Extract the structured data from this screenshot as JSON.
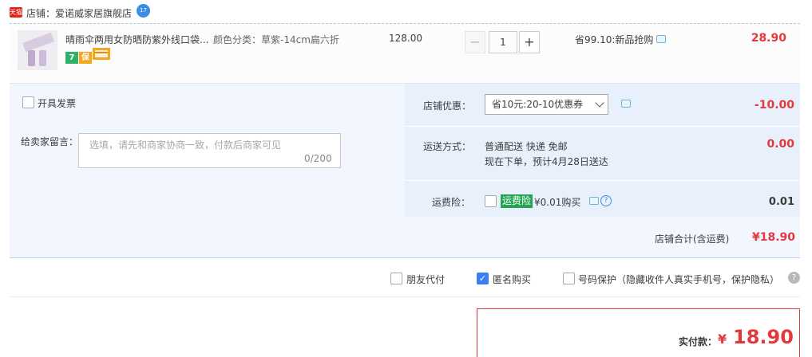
{
  "shop": {
    "badge": "天猫",
    "label": "店铺：爱诺威家居旗舰店",
    "ww_badge": "17"
  },
  "item": {
    "title": "晴雨伞两用女防晒防紫外线口袋...",
    "sku": "颜色分类：草紫-14cm扁六折",
    "price": "128.00",
    "quantity": "1",
    "qty_minus": "−",
    "qty_plus": "+",
    "promo": "省99.10:新品抢购",
    "total": "28.90",
    "service_icons": [
      "7",
      "保",
      "card-icon"
    ]
  },
  "invoice": {
    "label": "开具发票"
  },
  "message": {
    "label": "给卖家留言：",
    "placeholder": "选填，请先和商家协商一致，付款后商家可见",
    "counter": "0/200"
  },
  "coupon": {
    "label": "店铺优惠：",
    "selected": "省10元:20-10优惠券",
    "amount": "-10.00"
  },
  "shipping": {
    "label": "运送方式：",
    "method": "普通配送 快递 免邮",
    "eta": "现在下单，预计4月28日送达",
    "amount": "0.00"
  },
  "insurance": {
    "label": "运费险：",
    "badge": "运费险",
    "text": "¥0.01购买",
    "amount": "0.01"
  },
  "subtotal": {
    "label": "店铺合计(含运费)",
    "amount": "¥18.90"
  },
  "options": {
    "friend_pay": "朋友代付",
    "anonymous": "匿名购买",
    "anonymous_checked": true,
    "phone_protect": "号码保护（隐藏收件人真实手机号，保护隐私）"
  },
  "payment": {
    "label": "实付款：",
    "currency": "¥",
    "amount": "18.90"
  },
  "colors": {
    "accent_red": "#e4393c",
    "tmall_red": "#e2231a",
    "panel_blue": "#f2f7ff",
    "insurance_green": "#23a553",
    "checkbox_blue": "#3c7ff0"
  }
}
